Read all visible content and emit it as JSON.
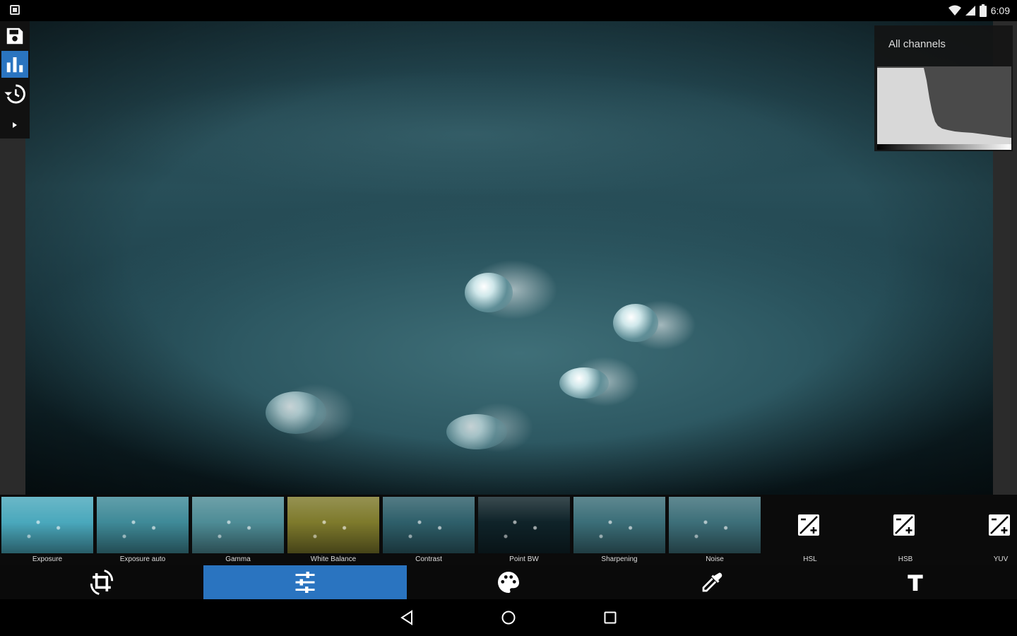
{
  "status_bar": {
    "time": "6:09",
    "icons": [
      "notification-icon",
      "wifi-icon",
      "signal-icon",
      "battery-icon"
    ]
  },
  "left_toolbar": {
    "items": [
      {
        "icon": "save-icon",
        "active": false
      },
      {
        "icon": "histogram-icon",
        "active": true
      },
      {
        "icon": "history-icon",
        "active": false
      },
      {
        "icon": "expand-arrow-icon",
        "active": false
      }
    ]
  },
  "histogram": {
    "label": "All channels"
  },
  "filters": [
    {
      "label": "Exposure",
      "tint": "#4aa8bc"
    },
    {
      "label": "Exposure auto",
      "tint": "#3f8a98"
    },
    {
      "label": "Gamma",
      "tint": "#4e8c96"
    },
    {
      "label": "White Balance",
      "tint": "#7e7a2c"
    },
    {
      "label": "Contrast",
      "tint": "#2e5f6a"
    },
    {
      "label": "Point BW",
      "tint": "#0f2329"
    },
    {
      "label": "Sharpening",
      "tint": "#3b6e78"
    },
    {
      "label": "Noise",
      "tint": "#3d6f79"
    },
    {
      "label": "HSL",
      "icon": "adjust-plus-icon"
    },
    {
      "label": "HSB",
      "icon": "adjust-plus-icon"
    },
    {
      "label": "YUV",
      "icon": "adjust-plus-icon"
    }
  ],
  "tabs": [
    {
      "icon": "crop-rotate-icon",
      "active": false
    },
    {
      "icon": "tune-sliders-icon",
      "active": true
    },
    {
      "icon": "palette-icon",
      "active": false
    },
    {
      "icon": "eyedropper-icon",
      "active": false
    },
    {
      "icon": "text-icon",
      "active": false
    }
  ],
  "nav": [
    "back-icon",
    "home-icon",
    "recents-icon"
  ]
}
